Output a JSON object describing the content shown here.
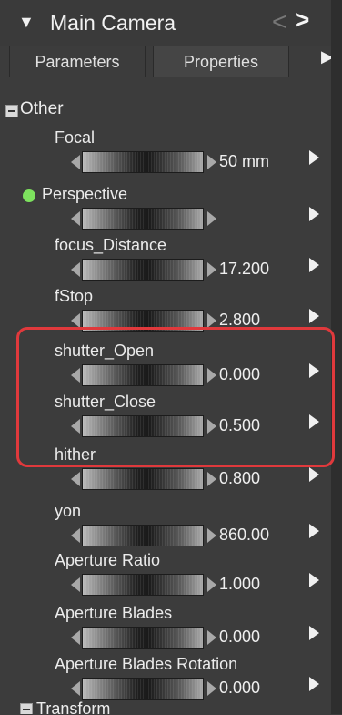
{
  "header": {
    "title": "Main Camera",
    "prev_icon": "‹",
    "next_icon": "›"
  },
  "tabs": [
    {
      "label": "Parameters",
      "active": true
    },
    {
      "label": "Properties",
      "active": false
    }
  ],
  "groups": {
    "other": {
      "label": "Other"
    },
    "transform": {
      "label": "Transform"
    }
  },
  "params": [
    {
      "label": "Focal",
      "value": "50 mm"
    },
    {
      "label": "Perspective",
      "value": ""
    },
    {
      "label": "focus_Distance",
      "value": "17.200"
    },
    {
      "label": "fStop",
      "value": "2.800"
    },
    {
      "label": "shutter_Open",
      "value": "0.000"
    },
    {
      "label": "shutter_Close",
      "value": "0.500"
    },
    {
      "label": "hither",
      "value": "0.800"
    },
    {
      "label": "yon",
      "value": "860.00"
    },
    {
      "label": "Aperture Ratio",
      "value": "1.000"
    },
    {
      "label": "Aperture Blades",
      "value": "0.000"
    },
    {
      "label": "Aperture Blades Rotation",
      "value": "0.000"
    }
  ],
  "colors": {
    "highlight": "#e0393c",
    "perspective_dot": "#7de25e"
  }
}
